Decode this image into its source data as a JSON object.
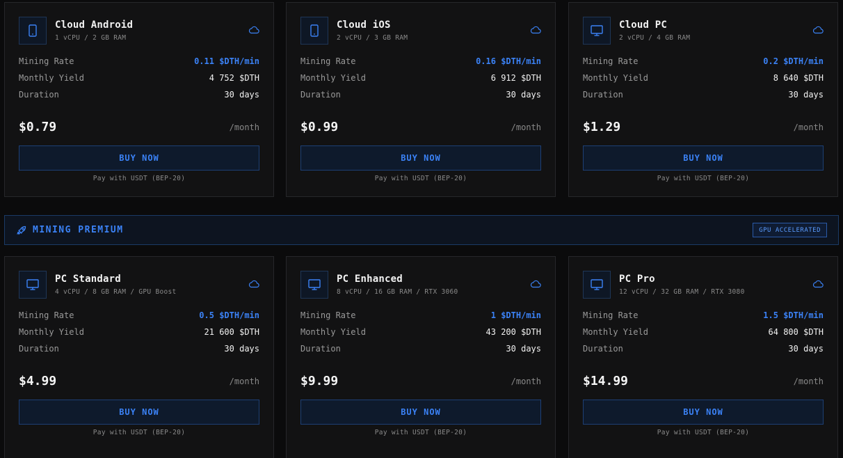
{
  "currency_note": "Pay with USDT (BEP-20)",
  "buy_label": "BUY NOW",
  "labels": {
    "rate": "Mining Rate",
    "yield": "Monthly Yield",
    "duration": "Duration"
  },
  "colors": {
    "accent": "#3b82f6",
    "background": "#0b0b0c",
    "card": "#121213"
  },
  "plans_top": [
    {
      "name": "Cloud Android",
      "spec": "1 vCPU / 2 GB RAM",
      "icon": "phone-icon",
      "rate": "0.11 $DTH/min",
      "yield": "4 752 $DTH",
      "duration": "30 days",
      "price": "$0.79",
      "period": "/month"
    },
    {
      "name": "Cloud iOS",
      "spec": "2 vCPU / 3 GB RAM",
      "icon": "phone-icon",
      "rate": "0.16 $DTH/min",
      "yield": "6 912 $DTH",
      "duration": "30 days",
      "price": "$0.99",
      "period": "/month"
    },
    {
      "name": "Cloud PC",
      "spec": "2 vCPU / 4 GB RAM",
      "icon": "monitor-icon",
      "rate": "0.2 $DTH/min",
      "yield": "8 640 $DTH",
      "duration": "30 days",
      "price": "$1.29",
      "period": "/month"
    }
  ],
  "section": {
    "title": "MINING PREMIUM",
    "badge": "GPU ACCELERATED",
    "icon": "rocket-icon"
  },
  "plans_bottom": [
    {
      "name": "PC Standard",
      "spec": "4 vCPU / 8 GB RAM / GPU Boost",
      "icon": "monitor-icon",
      "rate": "0.5 $DTH/min",
      "yield": "21 600 $DTH",
      "duration": "30 days",
      "price": "$4.99",
      "period": "/month"
    },
    {
      "name": "PC Enhanced",
      "spec": "8 vCPU / 16 GB RAM / RTX 3060",
      "icon": "monitor-icon",
      "rate": "1 $DTH/min",
      "yield": "43 200 $DTH",
      "duration": "30 days",
      "price": "$9.99",
      "period": "/month"
    },
    {
      "name": "PC Pro",
      "spec": "12 vCPU / 32 GB RAM / RTX 3080",
      "icon": "monitor-icon",
      "rate": "1.5 $DTH/min",
      "yield": "64 800 $DTH",
      "duration": "30 days",
      "price": "$14.99",
      "period": "/month"
    }
  ]
}
